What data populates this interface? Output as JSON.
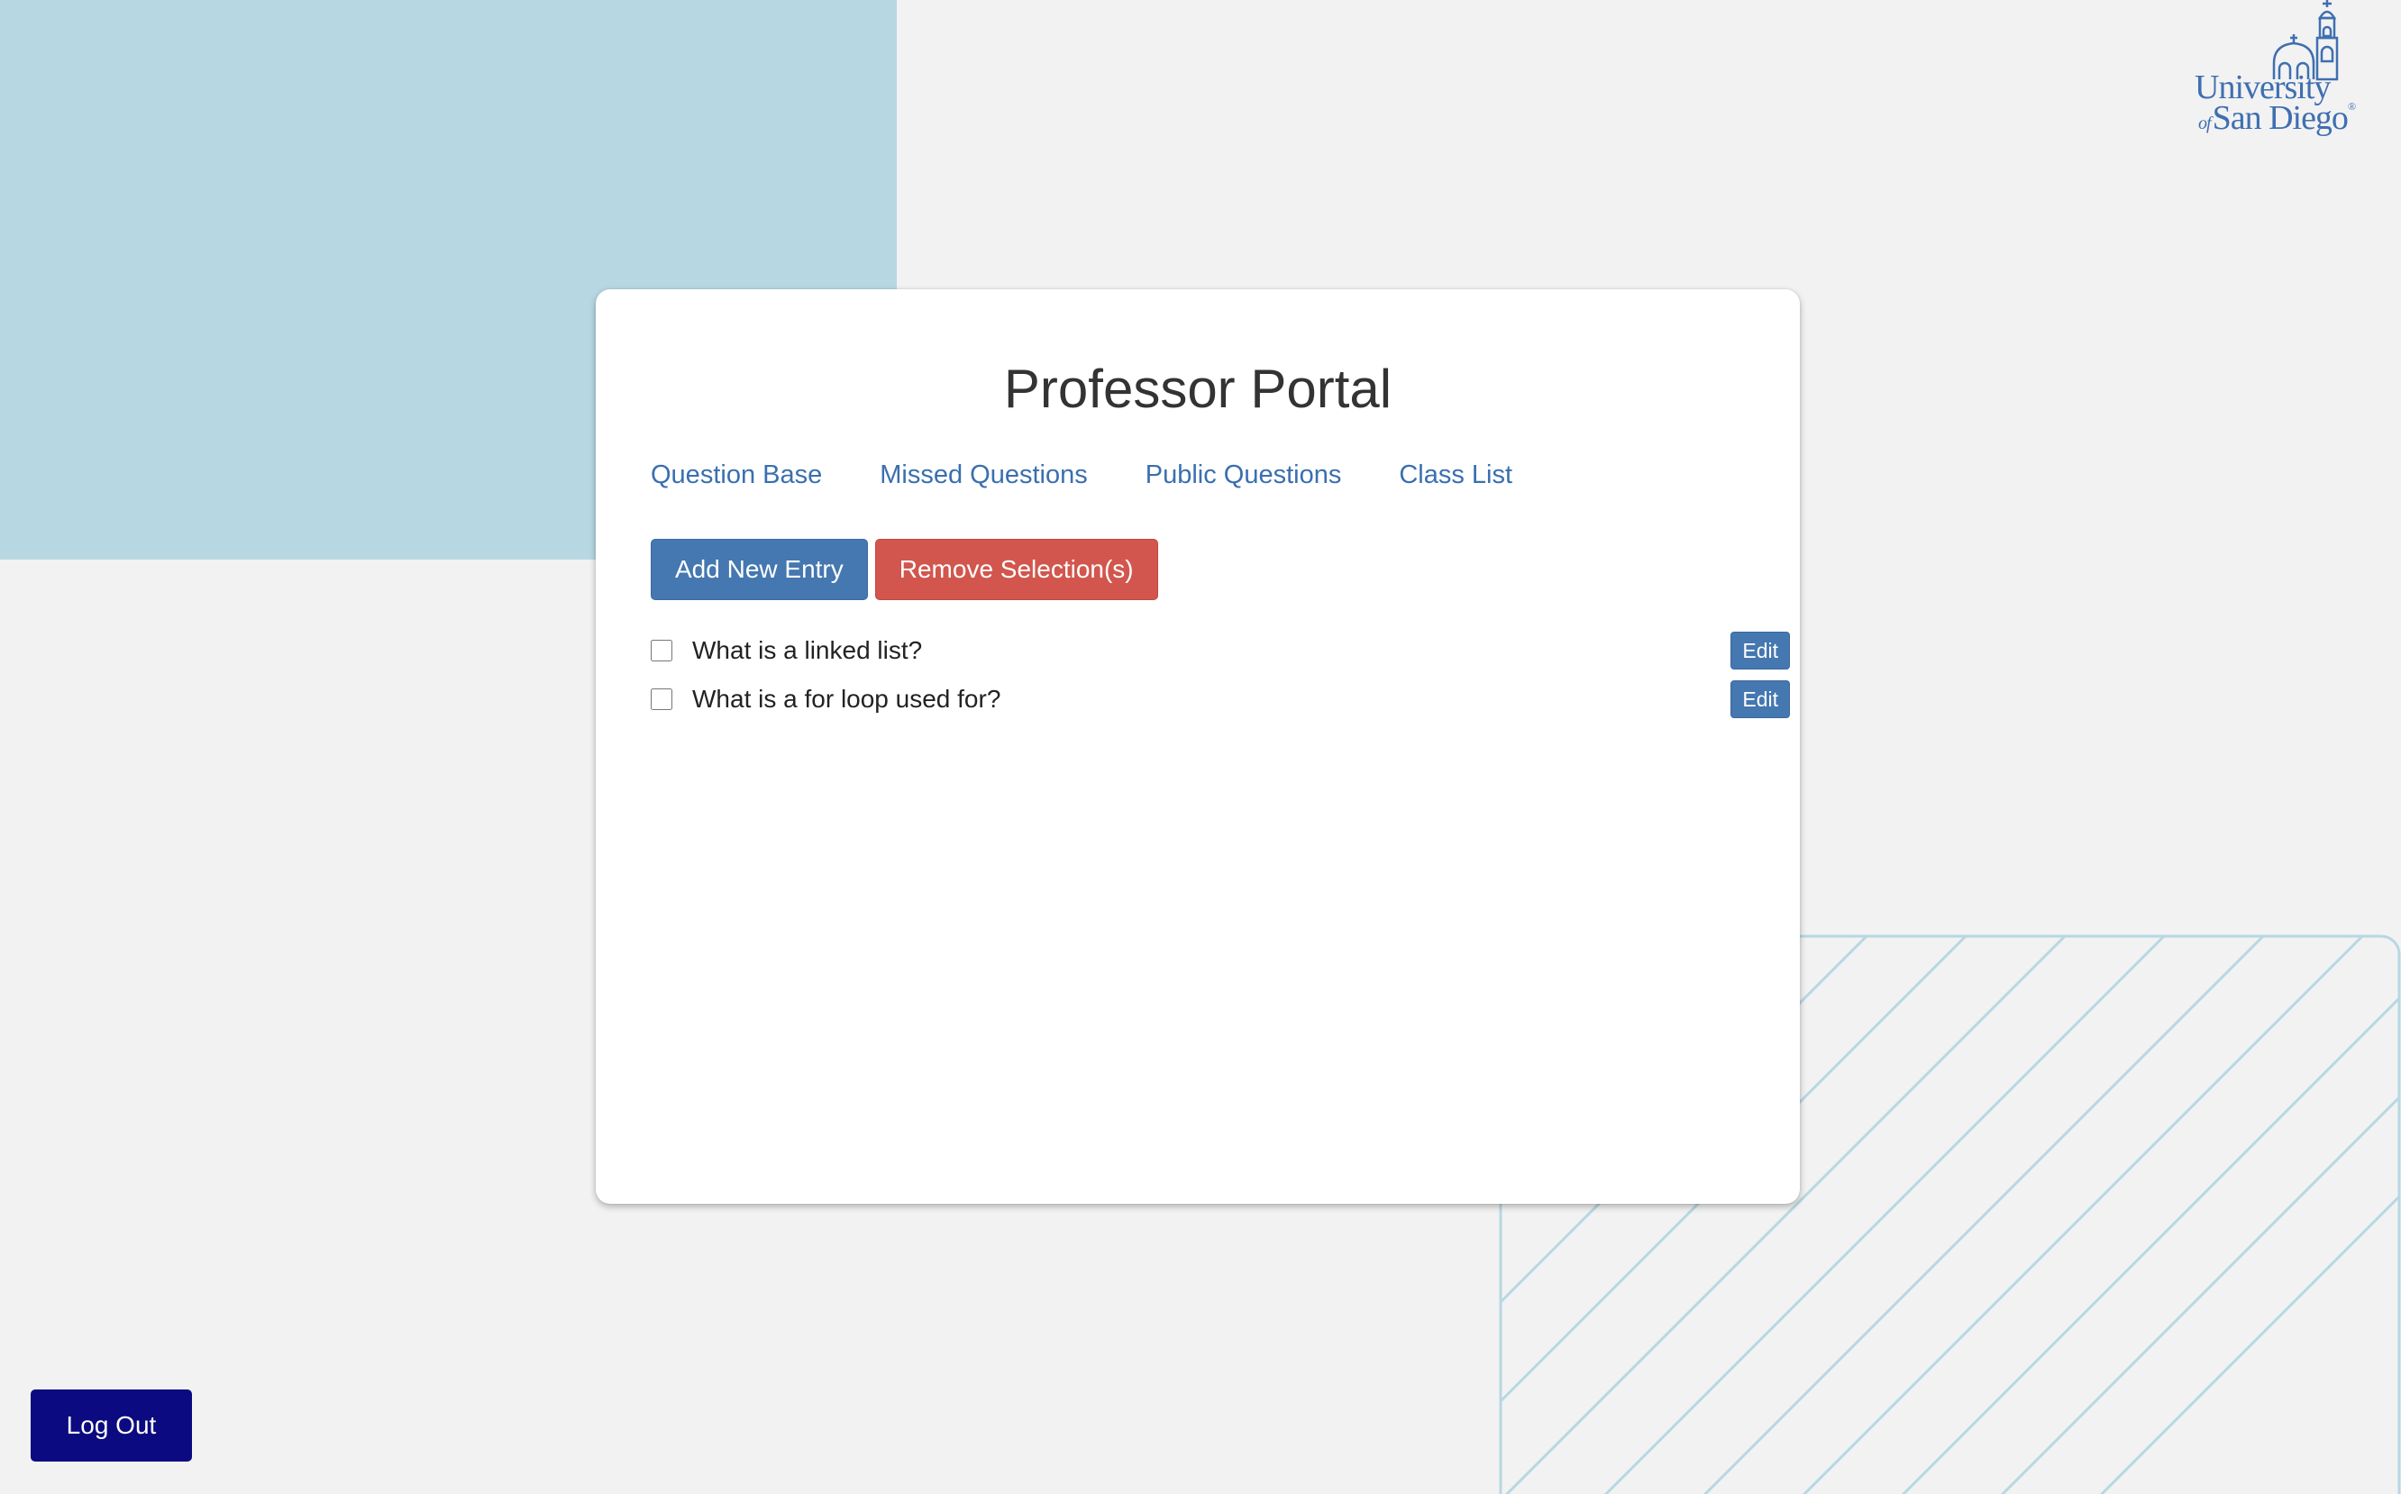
{
  "page": {
    "title": "Professor Portal"
  },
  "logo": {
    "line1": "University",
    "of": "of",
    "line2": "San Diego",
    "reg": "®"
  },
  "nav": {
    "items": [
      {
        "label": "Question Base"
      },
      {
        "label": "Missed Questions"
      },
      {
        "label": "Public Questions"
      },
      {
        "label": "Class List"
      }
    ]
  },
  "actions": {
    "add_label": "Add New Entry",
    "remove_label": "Remove Selection(s)"
  },
  "questions": [
    {
      "text": "What is a linked list?",
      "checked": false,
      "edit_label": "Edit"
    },
    {
      "text": "What is a for loop used for?",
      "checked": false,
      "edit_label": "Edit"
    }
  ],
  "footer": {
    "logout_label": "Log Out"
  },
  "colors": {
    "background": "#f2f2f2",
    "accent_block": "#b7d8e3",
    "primary": "#4577b0",
    "danger": "#d2564d",
    "logout": "#0b0a80",
    "link": "#3a6fb0"
  }
}
